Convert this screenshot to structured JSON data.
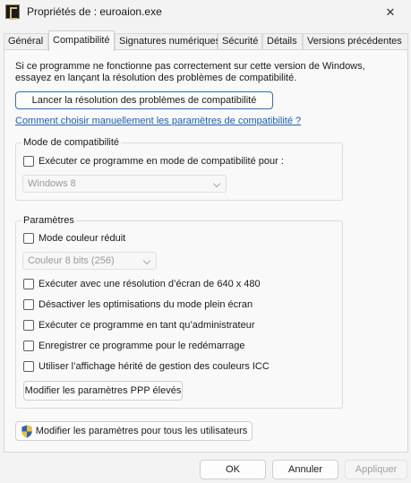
{
  "window": {
    "title": "Propriétés de : euroaion.exe"
  },
  "tabs": [
    {
      "label": "Général"
    },
    {
      "label": "Compatibilité"
    },
    {
      "label": "Signatures numériques"
    },
    {
      "label": "Sécurité"
    },
    {
      "label": "Détails"
    },
    {
      "label": "Versions précédentes"
    }
  ],
  "intro": {
    "text": "Si ce programme ne fonctionne pas correctement sur cette version de Windows, essayez en lançant la résolution des problèmes de compatibilité."
  },
  "troubleshoot_button": {
    "label": "Lancer la résolution des problèmes de compatibilité"
  },
  "manual_link": {
    "label": "Comment choisir manuellement les paramètres de compatibilité ?"
  },
  "compat_mode": {
    "legend": "Mode de compatibilité",
    "checkbox_label": "Exécuter ce programme en mode de compatibilité pour :",
    "select_value": "Windows 8"
  },
  "settings": {
    "legend": "Paramètres",
    "reduced_color_label": "Mode couleur réduit",
    "color_select_value": "Couleur 8 bits (256)",
    "options": [
      {
        "label": "Exécuter avec une résolution d’écran de 640 x 480"
      },
      {
        "label": "Désactiver les optimisations du mode plein écran"
      },
      {
        "label": "Exécuter ce programme en tant qu’administrateur"
      },
      {
        "label": "Enregistrer ce programme pour le redémarrage"
      },
      {
        "label": "Utiliser l’affichage hérité de gestion des couleurs ICC"
      }
    ],
    "dpi_button_label": "Modifier les paramètres PPP élevés"
  },
  "all_users_button": {
    "label": "Modifier les paramètres pour tous les utilisateurs"
  },
  "footer": {
    "ok": "OK",
    "cancel": "Annuler",
    "apply": "Appliquer"
  },
  "icons": {
    "app": "app-icon",
    "close": "close-icon",
    "shield": "uac-shield-icon",
    "dropdown": "chevron-down-icon"
  },
  "colors": {
    "link": "#1c5fb0",
    "focus_border": "#2f6fb8"
  }
}
